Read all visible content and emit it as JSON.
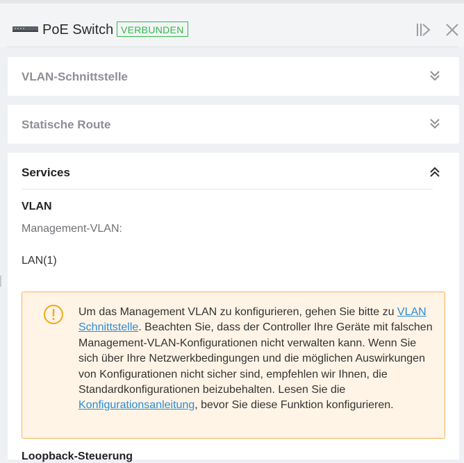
{
  "header": {
    "device_name": "PoE Switch",
    "status": "VERBUNDEN",
    "status_color": "#2fb94a",
    "icons": [
      "switch-device-icon",
      "collapse-panel-icon",
      "close-icon"
    ]
  },
  "sections": {
    "vlan_interface": {
      "title": "VLAN-Schnittstelle",
      "state": "collapsed",
      "icon": "double-chevron-down-icon"
    },
    "static_route": {
      "title": "Statische Route",
      "state": "collapsed",
      "icon": "double-chevron-down-icon"
    },
    "services": {
      "title": "Services",
      "state": "expanded",
      "icon": "double-chevron-up-icon",
      "vlan_heading": "VLAN",
      "mgmt_label": "Management-VLAN:",
      "mgmt_value": "LAN(1)",
      "warning": {
        "icon": "warning-circle-icon",
        "text_1": "Um das Management VLAN zu konfigurieren, gehen Sie bitte zu ",
        "link_1": "VLAN Schnittstelle",
        "text_2": ". Beachten Sie, dass der Controller Ihre Geräte mit falschen Management-VLAN-Konfigurationen nicht verwalten kann. Wenn Sie sich über Ihre Netzwerkbedingungen und die möglichen Auswirkungen von Konfigurationen nicht sicher sind, empfehlen wir Ihnen, die Standardkonfigurationen beizubehalten. Lesen Sie die ",
        "link_2": "Konfigurationsanleitung",
        "text_3": ", bevor Sie diese Funktion konfigurieren."
      },
      "next_heading": "Loopback-Steuerung"
    }
  },
  "colors": {
    "accent_link": "#2a8cd6",
    "warning_border": "#f5b556",
    "warning_bg": "#fff4e6",
    "warning_icon": "#f0a81c"
  }
}
